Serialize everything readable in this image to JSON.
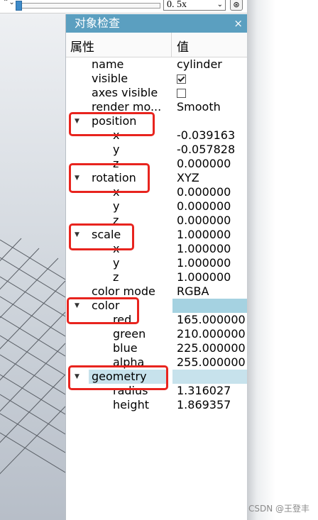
{
  "toolbar": {
    "left_arrows": "⌃⌄",
    "zoom_value": "0. 5x",
    "zoom_chevron": "⌄",
    "reset_icon": "⊛"
  },
  "panel": {
    "title": "对象检查",
    "close": "×",
    "col_property": "属性",
    "col_value": "值"
  },
  "rows": {
    "name": {
      "label": "name",
      "value": "cylinder"
    },
    "visible": {
      "label": "visible"
    },
    "axes_visible": {
      "label": "axes visible"
    },
    "render_mode": {
      "label": "render mo...",
      "value": "Smooth"
    },
    "position": {
      "label": "position",
      "x": "-0.039163",
      "y": "-0.057828",
      "z": "0.000000"
    },
    "rotation": {
      "label": "rotation",
      "value": "XYZ",
      "x": "0.000000",
      "y": "0.000000",
      "z": "0.000000"
    },
    "scale": {
      "label": "scale",
      "value": "1.000000",
      "x": "1.000000",
      "y": "1.000000",
      "z": "1.000000"
    },
    "color_mode": {
      "label": "color mode",
      "value": "RGBA"
    },
    "color": {
      "label": "color",
      "red": "165.000000",
      "green": "210.000000",
      "blue": "225.000000",
      "alpha": "255.000000"
    },
    "geometry": {
      "label": "geometry",
      "radius": "1.316027",
      "height": "1.869357"
    }
  },
  "sublabels": {
    "x": "x",
    "y": "y",
    "z": "z",
    "red": "red",
    "green": "green",
    "blue": "blue",
    "alpha": "alpha",
    "radius": "radius",
    "height": "height"
  },
  "states": {
    "visible_checked": true,
    "axes_visible_checked": false
  },
  "colors": {
    "title_bar": "#5b9fc0",
    "color_swatch": "#a5d2e1",
    "highlight": "#e8241e"
  },
  "watermark": "CSDN @王登丰"
}
